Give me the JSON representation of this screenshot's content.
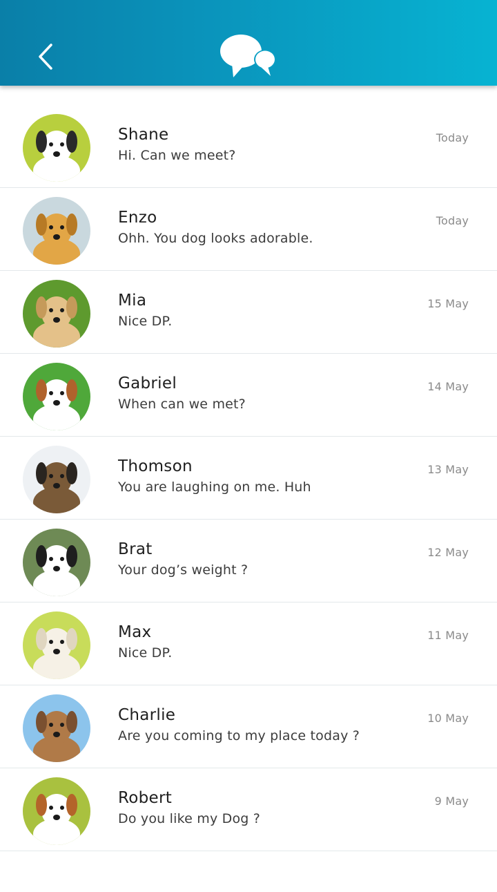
{
  "header": {
    "back_icon": "chevron-left-icon",
    "logo_icon": "chat-bubbles-icon"
  },
  "conversations": [
    {
      "name": "Shane",
      "message": "Hi. Can we meet?",
      "date": "Today",
      "avatar_bg": "#b8cf3e",
      "dog_color": "#ffffff",
      "dog_accent": "#2a2a2a"
    },
    {
      "name": "Enzo",
      "message": "Ohh. You dog looks adorable.",
      "date": "Today",
      "avatar_bg": "#c9d8de",
      "dog_color": "#e2a646",
      "dog_accent": "#b77a25"
    },
    {
      "name": "Mia",
      "message": "Nice DP.",
      "date": "15 May",
      "avatar_bg": "#5e9a2e",
      "dog_color": "#e4c189",
      "dog_accent": "#c59a5a"
    },
    {
      "name": "Gabriel",
      "message": "When can we met?",
      "date": "14 May",
      "avatar_bg": "#4fa83a",
      "dog_color": "#ffffff",
      "dog_accent": "#b0622c"
    },
    {
      "name": "Thomson",
      "message": "You are laughing on me. Huh",
      "date": "13 May",
      "avatar_bg": "#eef1f4",
      "dog_color": "#7a5a38",
      "dog_accent": "#2a2520"
    },
    {
      "name": "Brat",
      "message": "Your dog’s weight ?",
      "date": "12 May",
      "avatar_bg": "#6e8a55",
      "dog_color": "#ffffff",
      "dog_accent": "#1e1e1e"
    },
    {
      "name": "Max",
      "message": "Nice DP.",
      "date": "11 May",
      "avatar_bg": "#c8dc5a",
      "dog_color": "#f6f1e6",
      "dog_accent": "#e0d6c0"
    },
    {
      "name": "Charlie",
      "message": "Are you coming to my place today ?",
      "date": "10 May",
      "avatar_bg": "#8cc4ec",
      "dog_color": "#b07a48",
      "dog_accent": "#7a5030"
    },
    {
      "name": "Robert",
      "message": "Do you like my Dog ?",
      "date": "9 May",
      "avatar_bg": "#a9c13f",
      "dog_color": "#ffffff",
      "dog_accent": "#b4642a"
    }
  ]
}
